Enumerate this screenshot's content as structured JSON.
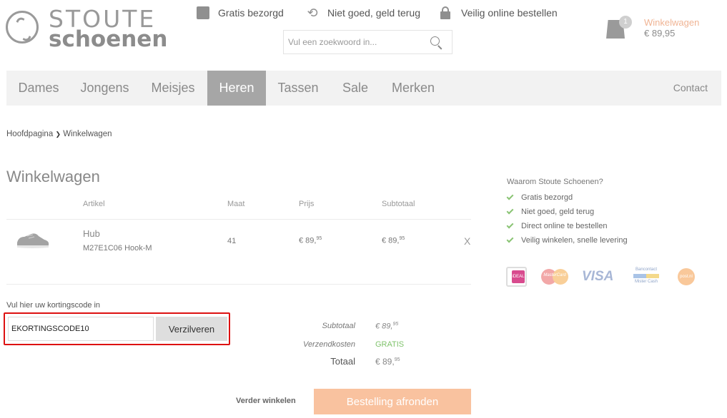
{
  "header": {
    "logo_top": "STOUTE",
    "logo_bottom": "schoenen",
    "usps": [
      "Gratis bezorgd",
      "Niet goed, geld terug",
      "Veilig online bestellen"
    ],
    "search_placeholder": "Vul een zoekwoord in...",
    "cart": {
      "count": "1",
      "label": "Winkelwagen",
      "total": "€ 89,95"
    }
  },
  "nav": {
    "items": [
      "Dames",
      "Jongens",
      "Meisjes",
      "Heren",
      "Tassen",
      "Sale",
      "Merken"
    ],
    "active": "Heren",
    "contact": "Contact"
  },
  "breadcrumb": {
    "home": "Hoofdpagina",
    "separator": "❯",
    "current": "Winkelwagen"
  },
  "page_title": "Winkelwagen",
  "table": {
    "headers": [
      "Artikel",
      "Maat",
      "Prijs",
      "Subtotaal"
    ],
    "rows": [
      {
        "name": "Hub",
        "sku": "M27E1C06 Hook-M",
        "size": "41",
        "price_main": "€ 89,",
        "price_cents": "95",
        "subtotal_main": "€ 89,",
        "subtotal_cents": "95",
        "remove": "X"
      }
    ]
  },
  "coupon": {
    "label": "Vul hier uw kortingscode in",
    "value": "EKORTINGSCODE10",
    "button": "Verzilveren"
  },
  "totals": {
    "subtotal_label": "Subtotaal",
    "subtotal_main": "€ 89,",
    "subtotal_cents": "95",
    "shipping_label": "Verzendkosten",
    "shipping_value": "GRATIS",
    "total_label": "Totaal",
    "total_main": "€ 89,",
    "total_cents": "95"
  },
  "actions": {
    "continue": "Verder winkelen",
    "checkout": "Bestelling afronden"
  },
  "why": {
    "title": "Waarom Stoute Schoenen?",
    "items": [
      "Gratis bezorgd",
      "Niet goed, geld terug",
      "Direct online te bestellen",
      "Veilig winkelen, snelle levering"
    ]
  },
  "payments": {
    "ideal": "iDEAL",
    "mastercard": "MasterCard",
    "visa": "VISA",
    "bancontact_top": "Bancontact",
    "bancontact_bottom": "Mister Cash",
    "postnl": "post.nl"
  },
  "colors": {
    "accent": "#f9c29f",
    "cart_label": "#f0b494",
    "nav_active": "#a6a6a6",
    "highlight": "#dd1111",
    "check": "#8ac474"
  }
}
